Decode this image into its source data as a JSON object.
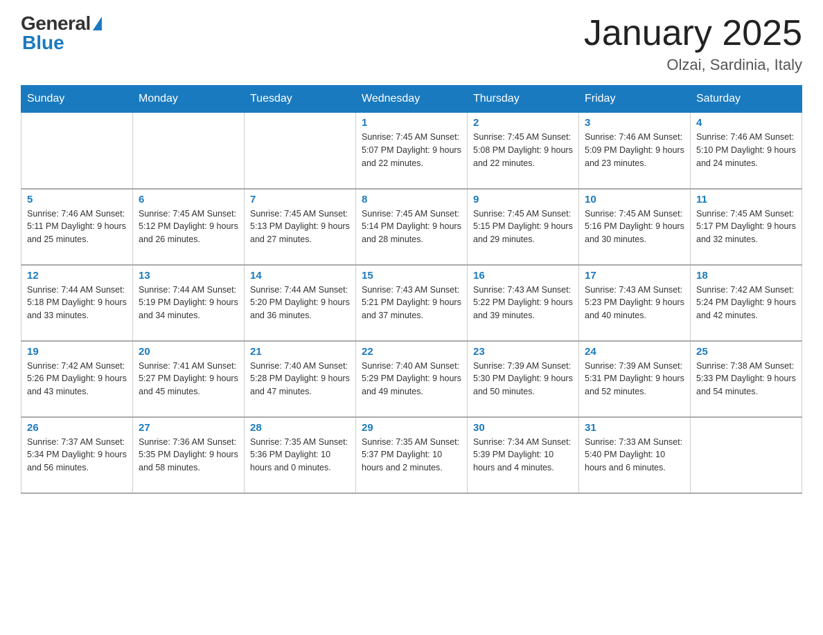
{
  "header": {
    "logo_general": "General",
    "logo_blue": "Blue",
    "title": "January 2025",
    "subtitle": "Olzai, Sardinia, Italy"
  },
  "days_of_week": [
    "Sunday",
    "Monday",
    "Tuesday",
    "Wednesday",
    "Thursday",
    "Friday",
    "Saturday"
  ],
  "weeks": [
    [
      {
        "day": "",
        "info": ""
      },
      {
        "day": "",
        "info": ""
      },
      {
        "day": "",
        "info": ""
      },
      {
        "day": "1",
        "info": "Sunrise: 7:45 AM\nSunset: 5:07 PM\nDaylight: 9 hours\nand 22 minutes."
      },
      {
        "day": "2",
        "info": "Sunrise: 7:45 AM\nSunset: 5:08 PM\nDaylight: 9 hours\nand 22 minutes."
      },
      {
        "day": "3",
        "info": "Sunrise: 7:46 AM\nSunset: 5:09 PM\nDaylight: 9 hours\nand 23 minutes."
      },
      {
        "day": "4",
        "info": "Sunrise: 7:46 AM\nSunset: 5:10 PM\nDaylight: 9 hours\nand 24 minutes."
      }
    ],
    [
      {
        "day": "5",
        "info": "Sunrise: 7:46 AM\nSunset: 5:11 PM\nDaylight: 9 hours\nand 25 minutes."
      },
      {
        "day": "6",
        "info": "Sunrise: 7:45 AM\nSunset: 5:12 PM\nDaylight: 9 hours\nand 26 minutes."
      },
      {
        "day": "7",
        "info": "Sunrise: 7:45 AM\nSunset: 5:13 PM\nDaylight: 9 hours\nand 27 minutes."
      },
      {
        "day": "8",
        "info": "Sunrise: 7:45 AM\nSunset: 5:14 PM\nDaylight: 9 hours\nand 28 minutes."
      },
      {
        "day": "9",
        "info": "Sunrise: 7:45 AM\nSunset: 5:15 PM\nDaylight: 9 hours\nand 29 minutes."
      },
      {
        "day": "10",
        "info": "Sunrise: 7:45 AM\nSunset: 5:16 PM\nDaylight: 9 hours\nand 30 minutes."
      },
      {
        "day": "11",
        "info": "Sunrise: 7:45 AM\nSunset: 5:17 PM\nDaylight: 9 hours\nand 32 minutes."
      }
    ],
    [
      {
        "day": "12",
        "info": "Sunrise: 7:44 AM\nSunset: 5:18 PM\nDaylight: 9 hours\nand 33 minutes."
      },
      {
        "day": "13",
        "info": "Sunrise: 7:44 AM\nSunset: 5:19 PM\nDaylight: 9 hours\nand 34 minutes."
      },
      {
        "day": "14",
        "info": "Sunrise: 7:44 AM\nSunset: 5:20 PM\nDaylight: 9 hours\nand 36 minutes."
      },
      {
        "day": "15",
        "info": "Sunrise: 7:43 AM\nSunset: 5:21 PM\nDaylight: 9 hours\nand 37 minutes."
      },
      {
        "day": "16",
        "info": "Sunrise: 7:43 AM\nSunset: 5:22 PM\nDaylight: 9 hours\nand 39 minutes."
      },
      {
        "day": "17",
        "info": "Sunrise: 7:43 AM\nSunset: 5:23 PM\nDaylight: 9 hours\nand 40 minutes."
      },
      {
        "day": "18",
        "info": "Sunrise: 7:42 AM\nSunset: 5:24 PM\nDaylight: 9 hours\nand 42 minutes."
      }
    ],
    [
      {
        "day": "19",
        "info": "Sunrise: 7:42 AM\nSunset: 5:26 PM\nDaylight: 9 hours\nand 43 minutes."
      },
      {
        "day": "20",
        "info": "Sunrise: 7:41 AM\nSunset: 5:27 PM\nDaylight: 9 hours\nand 45 minutes."
      },
      {
        "day": "21",
        "info": "Sunrise: 7:40 AM\nSunset: 5:28 PM\nDaylight: 9 hours\nand 47 minutes."
      },
      {
        "day": "22",
        "info": "Sunrise: 7:40 AM\nSunset: 5:29 PM\nDaylight: 9 hours\nand 49 minutes."
      },
      {
        "day": "23",
        "info": "Sunrise: 7:39 AM\nSunset: 5:30 PM\nDaylight: 9 hours\nand 50 minutes."
      },
      {
        "day": "24",
        "info": "Sunrise: 7:39 AM\nSunset: 5:31 PM\nDaylight: 9 hours\nand 52 minutes."
      },
      {
        "day": "25",
        "info": "Sunrise: 7:38 AM\nSunset: 5:33 PM\nDaylight: 9 hours\nand 54 minutes."
      }
    ],
    [
      {
        "day": "26",
        "info": "Sunrise: 7:37 AM\nSunset: 5:34 PM\nDaylight: 9 hours\nand 56 minutes."
      },
      {
        "day": "27",
        "info": "Sunrise: 7:36 AM\nSunset: 5:35 PM\nDaylight: 9 hours\nand 58 minutes."
      },
      {
        "day": "28",
        "info": "Sunrise: 7:35 AM\nSunset: 5:36 PM\nDaylight: 10 hours\nand 0 minutes."
      },
      {
        "day": "29",
        "info": "Sunrise: 7:35 AM\nSunset: 5:37 PM\nDaylight: 10 hours\nand 2 minutes."
      },
      {
        "day": "30",
        "info": "Sunrise: 7:34 AM\nSunset: 5:39 PM\nDaylight: 10 hours\nand 4 minutes."
      },
      {
        "day": "31",
        "info": "Sunrise: 7:33 AM\nSunset: 5:40 PM\nDaylight: 10 hours\nand 6 minutes."
      },
      {
        "day": "",
        "info": ""
      }
    ]
  ]
}
